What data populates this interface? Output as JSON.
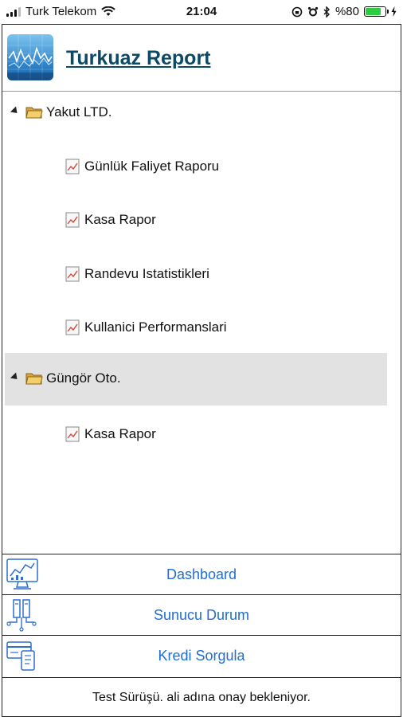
{
  "status_bar": {
    "carrier": "Turk Telekom",
    "time": "21:04",
    "battery_text": "%80",
    "battery_level": 0.8
  },
  "header": {
    "title": "Turkuaz Report",
    "logo_icon": "stock-chart-icon"
  },
  "tree": [
    {
      "label": "Yakut LTD.",
      "icon": "folder-icon",
      "expanded": true,
      "children": [
        {
          "label": "Günlük Faliyet Raporu",
          "icon": "report-icon"
        },
        {
          "label": "Kasa Rapor",
          "icon": "report-icon"
        },
        {
          "label": "Randevu Istatistikleri",
          "icon": "report-icon"
        },
        {
          "label": "Kullanici Performanslari",
          "icon": "report-icon"
        }
      ]
    },
    {
      "label": "Güngör Oto.",
      "icon": "folder-icon",
      "expanded": true,
      "selected": true,
      "children": [
        {
          "label": "Kasa Rapor",
          "icon": "report-icon"
        }
      ]
    }
  ],
  "menu": [
    {
      "label": "Dashboard",
      "icon": "dashboard-icon"
    },
    {
      "label": "Sunucu Durum",
      "icon": "server-icon"
    },
    {
      "label": "Kredi Sorgula",
      "icon": "credit-card-icon"
    }
  ],
  "footer": {
    "message": "Test Sürüşü. ali adına onay bekleniyor."
  },
  "colors": {
    "title": "#0b4a64",
    "link": "#1f6ed1",
    "selected_row": "#e2e2e2",
    "battery": "#2ecc40"
  }
}
